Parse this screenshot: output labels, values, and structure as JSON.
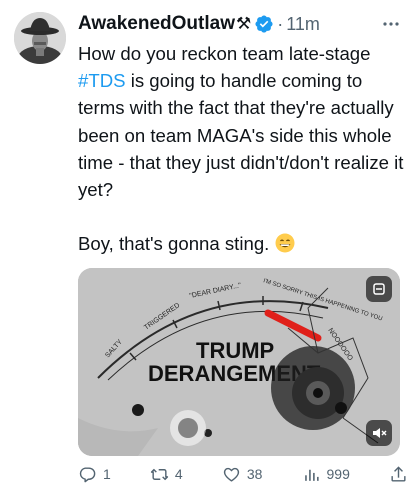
{
  "post": {
    "author_name": "AwakenedOutlaw",
    "name_emoji": "⚒",
    "separator": "·",
    "time": "11m",
    "text_before_hashtag": "How do you reckon team late-stage ",
    "hashtag": "#TDS",
    "text_after_hashtag": " is going to handle coming to terms with the fact that they're actually been on team MAGA's side this whole time - that they just didn't/don't realize it yet?",
    "text_second": "Boy, that's gonna sting. "
  },
  "media": {
    "gauge_labels": [
      "SALTY",
      "TRIGGERED",
      "\"DEAR DIARY...\"",
      "I'M SO SORRY THIS IS HAPPENING TO YOU",
      "NOOOOOO"
    ],
    "headline_line1": "TRUMP",
    "headline_line2": "DERANGEMENT"
  },
  "actions": {
    "replies": "1",
    "reposts": "4",
    "likes": "38",
    "views": "999"
  },
  "colors": {
    "link": "#1d9bf0",
    "verified": "#1d9bf0",
    "secondary_text": "#536471",
    "needle": "#e0201a"
  },
  "icons": {
    "avatar": "cowboy-avatar",
    "verified": "verified-badge-icon",
    "more": "more-icon",
    "reply": "reply-icon",
    "repost": "repost-icon",
    "like": "like-icon",
    "views": "views-icon",
    "share": "share-icon"
  }
}
